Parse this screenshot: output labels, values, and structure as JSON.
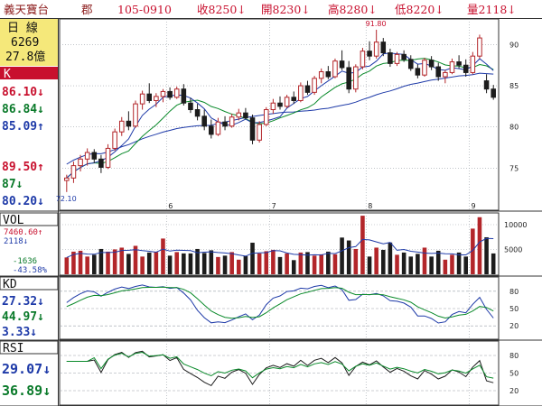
{
  "header": {
    "name": "義天寶台",
    "code": "郡",
    "date": "105-0910",
    "close": "收8250↓",
    "open": "開8230↓",
    "high": "高8280↓",
    "low": "低8220↓",
    "volume": "量2118↓"
  },
  "sidebar": {
    "period_label": "日  線",
    "count": "6269",
    "amount": "27.8億",
    "k_label": "K",
    "ma_values": [
      {
        "text": "86.10↓",
        "color": "red"
      },
      {
        "text": "86.84↓",
        "color": "green"
      },
      {
        "text": "85.09↑",
        "color": "blue"
      },
      {
        "text": "89.50↑",
        "color": "red"
      },
      {
        "text": "87↓",
        "color": "green"
      },
      {
        "text": "80.20↓",
        "color": "blue"
      }
    ],
    "vol_label": "VOL",
    "vol_values": [
      {
        "text": "7460.60↑",
        "color": "red"
      },
      {
        "text": "2118↓",
        "color": "blue"
      },
      {
        "text": "-1636",
        "color": "green"
      },
      {
        "text": "-43.58%",
        "color": "blue"
      }
    ],
    "kd_label": "KD",
    "kd_values": [
      {
        "text": "27.32↓",
        "color": "blue"
      },
      {
        "text": "44.97↓",
        "color": "green"
      },
      {
        "text": "3.33↓",
        "color": "blue"
      }
    ],
    "rsi_label": "RSI",
    "rsi_values": [
      {
        "text": "29.07↓",
        "color": "blue"
      },
      {
        "text": "36.89↓",
        "color": "green"
      }
    ]
  },
  "colors": {
    "up": "#b3262a",
    "down": "#1c1c1c",
    "ma_short": "#1e3aa8",
    "ma_mid": "#0a8a2a",
    "grid": "#9aa0a8",
    "gold": "#f5e87a",
    "label_red": "#c8102e"
  },
  "chart_data": {
    "type": "candlestick",
    "x_month_labels": [
      "6",
      "7",
      "8",
      "9"
    ],
    "x_month_index": [
      15,
      30,
      44,
      59
    ],
    "price_ylim": [
      70,
      93
    ],
    "price_ticks": [
      75,
      80,
      85,
      90
    ],
    "annotations": [
      {
        "text": "91.80",
        "index": 45,
        "value": 91.8
      },
      {
        "text": "72.10",
        "index": 0,
        "value": 72.1
      }
    ],
    "candles": [
      [
        73.5,
        74.2,
        72.1,
        73.8
      ],
      [
        73.8,
        75.8,
        73.2,
        75.3
      ],
      [
        75.3,
        76.6,
        74.6,
        76.1
      ],
      [
        76.1,
        77.4,
        75.3,
        76.9
      ],
      [
        76.9,
        77.3,
        75.6,
        76.1
      ],
      [
        76.1,
        76.6,
        74.4,
        75.1
      ],
      [
        75.1,
        77.9,
        74.9,
        77.4
      ],
      [
        77.4,
        79.8,
        77.1,
        79.4
      ],
      [
        79.4,
        81.2,
        78.9,
        80.7
      ],
      [
        80.7,
        81.9,
        79.6,
        80.1
      ],
      [
        80.1,
        83.2,
        79.9,
        82.8
      ],
      [
        82.8,
        84.4,
        82.1,
        84.0
      ],
      [
        84.0,
        85.3,
        82.9,
        83.2
      ],
      [
        83.2,
        84.1,
        82.4,
        83.7
      ],
      [
        83.7,
        84.6,
        83.0,
        84.3
      ],
      [
        84.3,
        84.8,
        83.3,
        83.6
      ],
      [
        83.6,
        84.9,
        83.4,
        84.6
      ],
      [
        84.6,
        85.2,
        82.6,
        82.9
      ],
      [
        82.9,
        83.5,
        81.7,
        82.1
      ],
      [
        82.1,
        82.8,
        80.8,
        81.3
      ],
      [
        81.3,
        82.1,
        79.6,
        80.1
      ],
      [
        80.1,
        80.9,
        78.6,
        79.1
      ],
      [
        79.1,
        81.1,
        78.9,
        80.6
      ],
      [
        80.6,
        81.3,
        79.6,
        80.1
      ],
      [
        80.1,
        81.6,
        79.9,
        81.2
      ],
      [
        81.2,
        82.2,
        80.8,
        81.7
      ],
      [
        81.7,
        82.3,
        80.9,
        81.1
      ],
      [
        81.1,
        81.5,
        77.9,
        78.4
      ],
      [
        78.4,
        80.7,
        78.1,
        80.3
      ],
      [
        80.3,
        82.4,
        80.1,
        82.1
      ],
      [
        82.1,
        83.4,
        81.6,
        82.9
      ],
      [
        82.9,
        83.7,
        82.1,
        82.5
      ],
      [
        82.5,
        83.9,
        82.3,
        83.6
      ],
      [
        83.6,
        84.3,
        82.8,
        83.2
      ],
      [
        83.2,
        85.4,
        83.0,
        85.0
      ],
      [
        85.0,
        85.6,
        83.9,
        84.2
      ],
      [
        84.2,
        86.2,
        83.9,
        85.9
      ],
      [
        85.9,
        87.1,
        85.3,
        86.7
      ],
      [
        86.7,
        87.4,
        85.8,
        86.1
      ],
      [
        86.1,
        88.3,
        85.9,
        88.0
      ],
      [
        88.0,
        89.3,
        86.9,
        87.2
      ],
      [
        87.2,
        88.0,
        84.1,
        84.6
      ],
      [
        84.6,
        87.6,
        84.2,
        87.3
      ],
      [
        87.3,
        89.6,
        87.0,
        89.2
      ],
      [
        89.2,
        90.4,
        88.1,
        88.6
      ],
      [
        88.6,
        91.8,
        88.3,
        90.3
      ],
      [
        90.3,
        90.8,
        88.6,
        89.0
      ],
      [
        89.0,
        89.5,
        87.3,
        87.7
      ],
      [
        87.7,
        89.1,
        87.4,
        88.8
      ],
      [
        88.8,
        89.3,
        87.9,
        88.2
      ],
      [
        88.2,
        88.7,
        86.8,
        87.1
      ],
      [
        87.1,
        87.6,
        85.9,
        86.3
      ],
      [
        86.3,
        88.4,
        86.1,
        88.1
      ],
      [
        88.1,
        88.6,
        86.9,
        87.3
      ],
      [
        87.3,
        87.8,
        85.6,
        86.1
      ],
      [
        86.1,
        86.9,
        85.3,
        86.6
      ],
      [
        86.6,
        88.3,
        86.4,
        87.9
      ],
      [
        87.9,
        88.7,
        87.1,
        87.5
      ],
      [
        87.5,
        88.2,
        86.1,
        86.6
      ],
      [
        86.6,
        89.1,
        86.4,
        88.6
      ],
      [
        88.6,
        91.2,
        88.3,
        90.8
      ],
      [
        85.6,
        86.4,
        84.1,
        84.6
      ],
      [
        84.6,
        85.1,
        83.3,
        83.6
      ]
    ],
    "vol_ticks": [
      5000,
      10000
    ],
    "vol_ylim": [
      0,
      12000
    ],
    "kd_ticks": [
      20,
      50,
      80
    ],
    "rsi_ticks": [
      20,
      50,
      80
    ]
  }
}
